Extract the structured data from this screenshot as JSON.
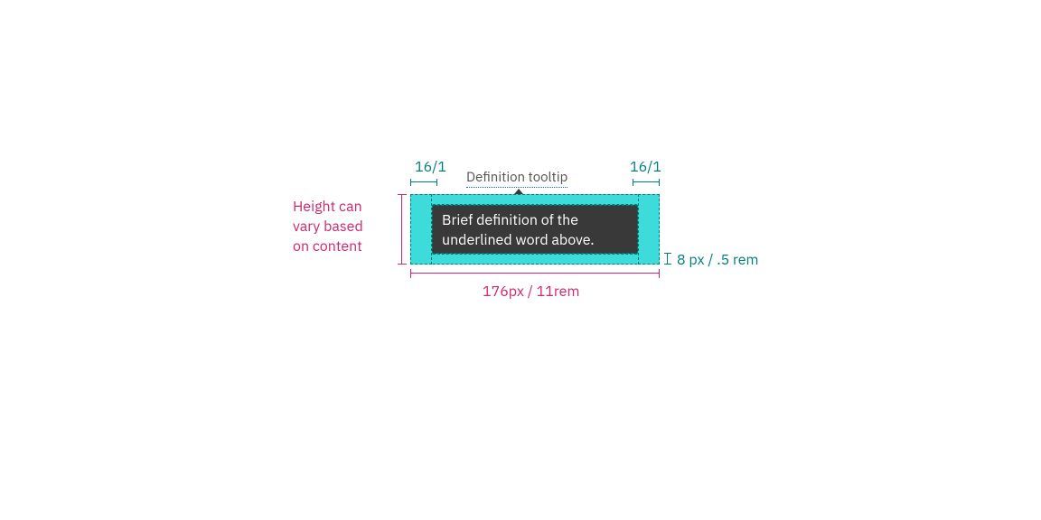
{
  "trigger": {
    "label": "Definition tooltip"
  },
  "tooltip": {
    "text_line1": "Brief definition of the",
    "text_line2": "underlined word above."
  },
  "annotations": {
    "pad_left": "16/1",
    "pad_right": "16/1",
    "height_note_line1": "Height can",
    "height_note_line2": "vary based",
    "height_note_line3": "on content",
    "width": "176px / 11rem",
    "bottom_pad": "8 px / .5 rem"
  }
}
